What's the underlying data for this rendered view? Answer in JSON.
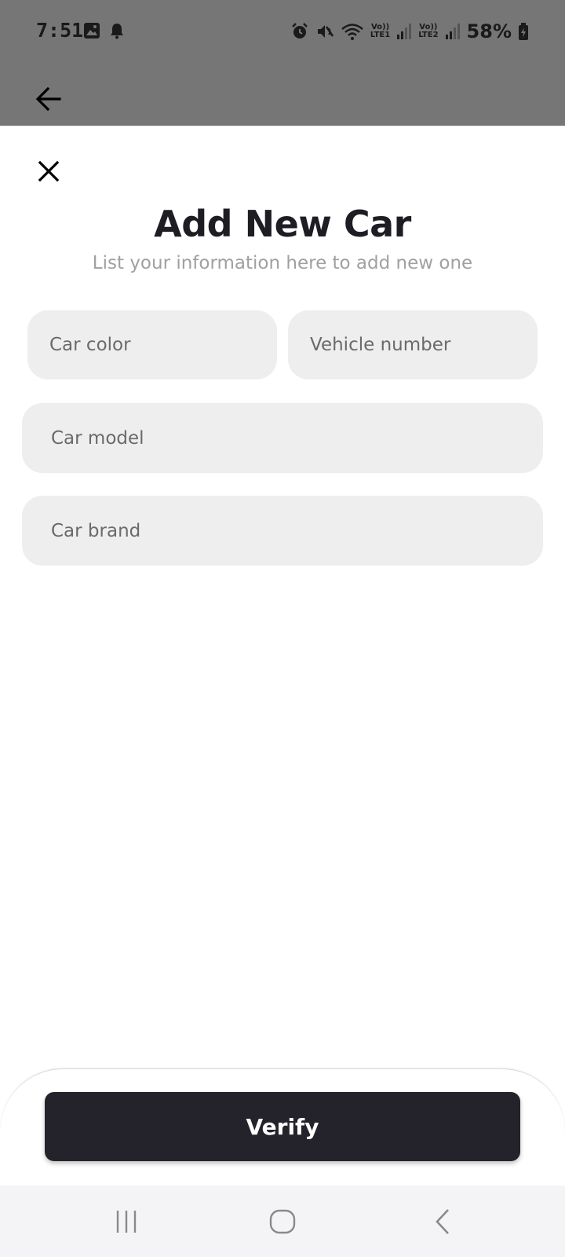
{
  "status_bar": {
    "time": "7:51",
    "left_icons": [
      "image-icon",
      "bell-icon"
    ],
    "right_icons": [
      "alarm-icon",
      "mute-icon",
      "wifi-icon",
      "signal-icon",
      "signal-icon"
    ],
    "sim1_top": "Vo))",
    "sim1_bottom": "LTE1",
    "sim2_top": "Vo))",
    "sim2_bottom": "LTE2",
    "battery": "58%"
  },
  "app_bar": {
    "back_icon": "arrow-left-icon"
  },
  "sheet": {
    "close_icon": "close-icon",
    "title": "Add New Car",
    "subtitle": "List your information here to add new one",
    "fields": {
      "car_color": "Car color",
      "vehicle_number": "Vehicle number",
      "car_model": "Car model",
      "car_brand": "Car brand"
    }
  },
  "actions": {
    "verify_label": "Verify"
  },
  "nav_bar": {
    "buttons": [
      "recent-apps-icon",
      "home-icon",
      "back-icon"
    ]
  },
  "colors": {
    "dim_overlay": "#767676",
    "field_bg": "#eeeeee",
    "primary_button": "#24232b",
    "title_text": "#1e1d24",
    "subtitle_text": "#a0a0a0"
  }
}
